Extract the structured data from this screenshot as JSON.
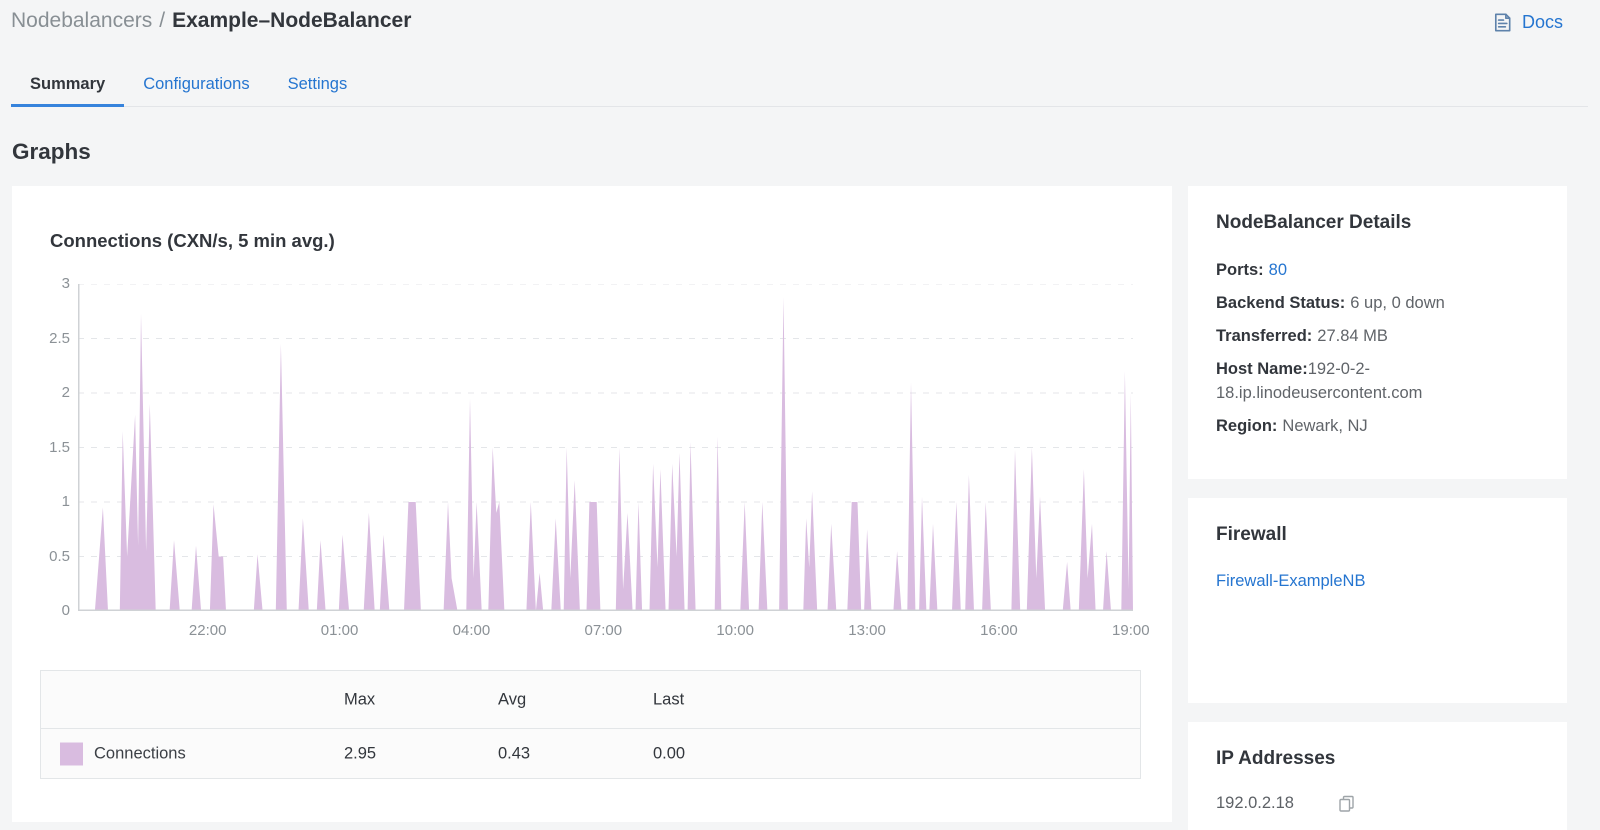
{
  "breadcrumb": {
    "section": "Nodebalancers",
    "separator": "/",
    "current": "Example–NodeBalancer"
  },
  "header": {
    "docs_label": "Docs"
  },
  "tabs": [
    {
      "label": "Summary",
      "active": true
    },
    {
      "label": "Configurations",
      "active": false
    },
    {
      "label": "Settings",
      "active": false
    }
  ],
  "page": {
    "section_title": "Graphs"
  },
  "colors": {
    "accent_blue": "#2575d0",
    "tab_underline": "#3683dc",
    "area_purple": "#d9bce0",
    "page_bg": "#f4f5f6"
  },
  "chart_data": {
    "type": "area",
    "title": "Connections (CXN/s, 5 min avg.)",
    "series_name": "Connections",
    "unit": "CXN/s",
    "color": "#d9bce0",
    "ylim": [
      0,
      3
    ],
    "yticks": [
      0,
      0.5,
      1,
      1.5,
      2,
      2.5,
      3
    ],
    "xticks": [
      "22:00",
      "01:00",
      "04:00",
      "07:00",
      "10:00",
      "13:00",
      "16:00",
      "19:00"
    ],
    "xtick_minutes": [
      177,
      357,
      537,
      717,
      897,
      1077,
      1257,
      1437
    ],
    "window_minutes": 1440,
    "grid": "dashed-horizontal",
    "legend_position": "table-below",
    "stats": {
      "max": "2.95",
      "avg": "0.43",
      "last": "0.00"
    },
    "points": [
      [
        0,
        0
      ],
      [
        23,
        0
      ],
      [
        34,
        0.95
      ],
      [
        41,
        0
      ],
      [
        57,
        0
      ],
      [
        61,
        1.65
      ],
      [
        67,
        0.5
      ],
      [
        78,
        1.8
      ],
      [
        82,
        0.6
      ],
      [
        86,
        2.73
      ],
      [
        93,
        0.55
      ],
      [
        98,
        1.9
      ],
      [
        106,
        0
      ],
      [
        125,
        0
      ],
      [
        131,
        0.65
      ],
      [
        139,
        0
      ],
      [
        155,
        0
      ],
      [
        161,
        0.6
      ],
      [
        168,
        0
      ],
      [
        180,
        0
      ],
      [
        185,
        0.98
      ],
      [
        192,
        0.5
      ],
      [
        198,
        0.5
      ],
      [
        202,
        0
      ],
      [
        240,
        0
      ],
      [
        245,
        0.52
      ],
      [
        252,
        0
      ],
      [
        270,
        0
      ],
      [
        277,
        2.45
      ],
      [
        285,
        0
      ],
      [
        301,
        0
      ],
      [
        307,
        0.85
      ],
      [
        315,
        0
      ],
      [
        326,
        0
      ],
      [
        331,
        0.65
      ],
      [
        338,
        0
      ],
      [
        356,
        0
      ],
      [
        361,
        0.7
      ],
      [
        370,
        0
      ],
      [
        390,
        0
      ],
      [
        397,
        0.9
      ],
      [
        405,
        0
      ],
      [
        412,
        0
      ],
      [
        417,
        0.7
      ],
      [
        425,
        0
      ],
      [
        445,
        0
      ],
      [
        451,
        1.0
      ],
      [
        461,
        1.0
      ],
      [
        468,
        0
      ],
      [
        499,
        0
      ],
      [
        505,
        1.0
      ],
      [
        510,
        0.3
      ],
      [
        518,
        0
      ],
      [
        530,
        0
      ],
      [
        535,
        1.95
      ],
      [
        540,
        0.3
      ],
      [
        544,
        1.0
      ],
      [
        551,
        0
      ],
      [
        560,
        0
      ],
      [
        566,
        1.5
      ],
      [
        571,
        0.9
      ],
      [
        575,
        1.0
      ],
      [
        582,
        0
      ],
      [
        612,
        0
      ],
      [
        618,
        1.0
      ],
      [
        625,
        0
      ],
      [
        630,
        0.35
      ],
      [
        635,
        0
      ],
      [
        646,
        0
      ],
      [
        652,
        0.85
      ],
      [
        659,
        0
      ],
      [
        663,
        0
      ],
      [
        667,
        1.5
      ],
      [
        672,
        0.3
      ],
      [
        678,
        1.2
      ],
      [
        685,
        0
      ],
      [
        694,
        0
      ],
      [
        698,
        1.0
      ],
      [
        708,
        1.0
      ],
      [
        713,
        0
      ],
      [
        734,
        0
      ],
      [
        739,
        1.5
      ],
      [
        744,
        0.2
      ],
      [
        750,
        0.9
      ],
      [
        757,
        0
      ],
      [
        761,
        0
      ],
      [
        765,
        1.0
      ],
      [
        770,
        0
      ],
      [
        780,
        0
      ],
      [
        785,
        1.35
      ],
      [
        791,
        0.4
      ],
      [
        795,
        1.3
      ],
      [
        802,
        0
      ],
      [
        806,
        0
      ],
      [
        811,
        1.35
      ],
      [
        817,
        0.5
      ],
      [
        821,
        1.45
      ],
      [
        828,
        0
      ],
      [
        832,
        0
      ],
      [
        836,
        1.55
      ],
      [
        843,
        0
      ],
      [
        869,
        0
      ],
      [
        873,
        1.6
      ],
      [
        878,
        0
      ],
      [
        904,
        0
      ],
      [
        910,
        1.0
      ],
      [
        916,
        0
      ],
      [
        929,
        0
      ],
      [
        934,
        1.0
      ],
      [
        941,
        0
      ],
      [
        957,
        0
      ],
      [
        963,
        2.88
      ],
      [
        969,
        0
      ],
      [
        990,
        0
      ],
      [
        994,
        0.85
      ],
      [
        998,
        0.4
      ],
      [
        1002,
        1.1
      ],
      [
        1009,
        0
      ],
      [
        1023,
        0
      ],
      [
        1028,
        0.8
      ],
      [
        1035,
        0
      ],
      [
        1050,
        0
      ],
      [
        1056,
        1.0
      ],
      [
        1064,
        1.0
      ],
      [
        1069,
        0
      ],
      [
        1073,
        0
      ],
      [
        1077,
        0.75
      ],
      [
        1083,
        0
      ],
      [
        1113,
        0
      ],
      [
        1118,
        0.55
      ],
      [
        1124,
        0
      ],
      [
        1132,
        0
      ],
      [
        1137,
        2.1
      ],
      [
        1143,
        0
      ],
      [
        1148,
        0
      ],
      [
        1152,
        1.05
      ],
      [
        1158,
        0
      ],
      [
        1162,
        0
      ],
      [
        1167,
        0.8
      ],
      [
        1173,
        0
      ],
      [
        1193,
        0
      ],
      [
        1199,
        1.0
      ],
      [
        1205,
        0
      ],
      [
        1211,
        0
      ],
      [
        1216,
        1.25
      ],
      [
        1223,
        0
      ],
      [
        1234,
        0
      ],
      [
        1239,
        1.0
      ],
      [
        1246,
        0
      ],
      [
        1274,
        0
      ],
      [
        1279,
        1.48
      ],
      [
        1286,
        0
      ],
      [
        1295,
        0
      ],
      [
        1302,
        1.5
      ],
      [
        1308,
        0.3
      ],
      [
        1313,
        1.05
      ],
      [
        1320,
        0
      ],
      [
        1344,
        0
      ],
      [
        1350,
        0.45
      ],
      [
        1355,
        0
      ],
      [
        1366,
        0
      ],
      [
        1373,
        1.3
      ],
      [
        1378,
        0.3
      ],
      [
        1384,
        0.8
      ],
      [
        1389,
        0
      ],
      [
        1399,
        0
      ],
      [
        1404,
        0.55
      ],
      [
        1410,
        0
      ],
      [
        1424,
        0
      ],
      [
        1429,
        2.2
      ],
      [
        1434,
        0.2
      ],
      [
        1437,
        2.0
      ],
      [
        1440,
        0
      ]
    ]
  },
  "legend_table": {
    "headers": {
      "max": "Max",
      "avg": "Avg",
      "last": "Last"
    },
    "row": {
      "label": "Connections",
      "max": "2.95",
      "avg": "0.43",
      "last": "0.00",
      "swatch_color": "#d9bce0"
    }
  },
  "details_panel": {
    "title": "NodeBalancer Details",
    "ports": {
      "label": "Ports:",
      "value": "80"
    },
    "backend": {
      "label": "Backend Status:",
      "value": "6 up, 0 down"
    },
    "transferred": {
      "label": "Transferred:",
      "value": "27.84 MB"
    },
    "hostname": {
      "label": "Host Name:",
      "value": "192-0-2-18.ip.linodeusercontent.com"
    },
    "region": {
      "label": "Region:",
      "value": "Newark, NJ"
    }
  },
  "firewall_panel": {
    "title": "Firewall",
    "link": "Firewall-ExampleNB"
  },
  "ip_panel": {
    "title": "IP Addresses",
    "ip": "192.0.2.18"
  }
}
